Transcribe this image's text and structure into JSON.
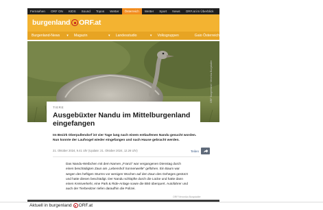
{
  "top_nav": {
    "items": [
      "Fernsehen",
      "ORF ON",
      "KIDS",
      "Sound",
      "Topos",
      "Wetter",
      "Österreich",
      "Wetter",
      "Sport",
      "News",
      "ORF.at im Überblick"
    ],
    "active_index": 6
  },
  "brand": {
    "name": "burgenland",
    "domain": "ORF.at"
  },
  "section_nav": {
    "items": [
      "Burgenland-News",
      "Magazin",
      "Landesstudio",
      "Volksgruppen",
      "Gaio Österreich"
    ]
  },
  "hero": {
    "side_credit": "ORF Burgenland / Veronika Burgstaller"
  },
  "article": {
    "rubric": "TIERE",
    "headline": "Ausgebüxter Nandu im Mittelburgenland eingefangen",
    "lead": "Im Bezirk Oberpullendorf ist vier Tage lang nach einem entlaufenen Nandu gesucht worden. Nun konnte der Laufvogel wieder eingefangen und nach Hause gebracht werden.",
    "meta": "21. Oktober 2024, 9.41 Uhr (Update: 21. Oktober 2024, 12.26 Uhr)",
    "share_label": "Teilen",
    "body": "Das Nandu-Weibchen mit dem Namen „Franzi“ war vergangenen Dienstag durch einen beschädigten Zaun am „Lebenshof Sonnenwelle“ geflohen. Ein Baum war wegen des heftigen Sturms vor wenigen Wochen auf den Zaun des Geheges gestürzt und hatte diesen beschädigt. Der Nandu schlüpfte durch die Lücke und hatte dann einen Kreisverkehr, eine Park & Ride-Anlage sowie die B50 überquert. Autofahrer und auch der Tierbesitzer riefen daraufhin die Polizei.",
    "photo_credit": "ORF/Veronika Burgstaller"
  },
  "footer": {
    "text": "Aktuell in burgenland",
    "domain": "ORF.at"
  },
  "colors": {
    "brand_orange": "#f3b331",
    "nav_orange": "#e7a423",
    "active_tab": "#f28c1e",
    "orf_red": "#c0141c"
  }
}
